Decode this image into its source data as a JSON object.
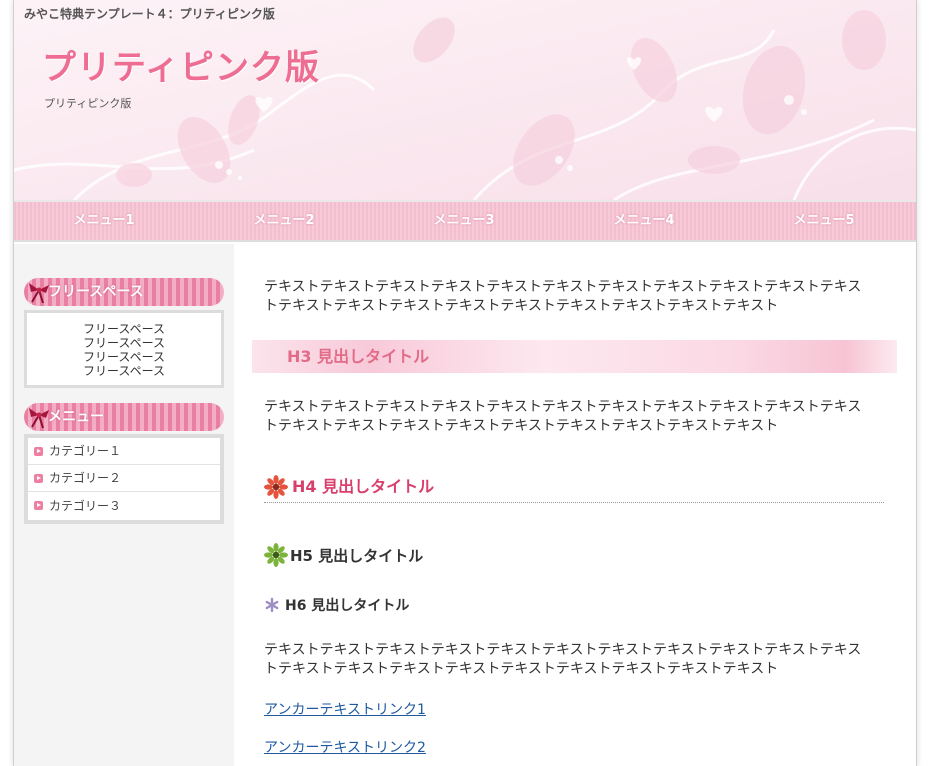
{
  "header": {
    "tagline": "みやこ特典テンプレート４：プリティピンク版",
    "title": "プリティピンク版",
    "subtitle": "プリティピンク版"
  },
  "nav": {
    "items": [
      "メニュー1",
      "メニュー2",
      "メニュー3",
      "メニュー4",
      "メニュー5"
    ]
  },
  "sidebar": {
    "free_space": {
      "heading": "フリースペース",
      "lines": [
        "フリースペース",
        "フリースペース",
        "フリースペース",
        "フリースペース"
      ]
    },
    "menu": {
      "heading": "メニュー",
      "categories": [
        "カテゴリー１",
        "カテゴリー２",
        "カテゴリー３"
      ]
    }
  },
  "main": {
    "paragraph1": "テキストテキストテキストテキストテキストテキストテキストテキストテキストテキストテキストテキストテキストテキストテキストテキストテキストテキストテキストテキスト",
    "h3": "H3 見出しタイトル",
    "paragraph2": "テキストテキストテキストテキストテキストテキストテキストテキストテキストテキストテキストテキストテキストテキストテキストテキストテキストテキストテキストテキスト",
    "h4": "H4 見出しタイトル",
    "h5": "H5 見出しタイトル",
    "h6": "H6 見出しタイトル",
    "paragraph3": "テキストテキストテキストテキストテキストテキストテキストテキストテキストテキストテキストテキストテキストテキストテキストテキストテキストテキストテキストテキスト",
    "link1": "アンカーテキストリンク1",
    "link2": "アンカーテキストリンク2"
  },
  "colors": {
    "accent": "#ee6d92",
    "nav": "#f3bfcf",
    "h4": "#d83f6c",
    "link": "#1f5aa0"
  },
  "icons": {
    "h4": "red-flower-icon",
    "h5": "green-flower-icon",
    "h6": "asterisk-icon",
    "sidebar_heading": "ribbon-icon",
    "category_bullet": "arrow-bullet-icon"
  }
}
